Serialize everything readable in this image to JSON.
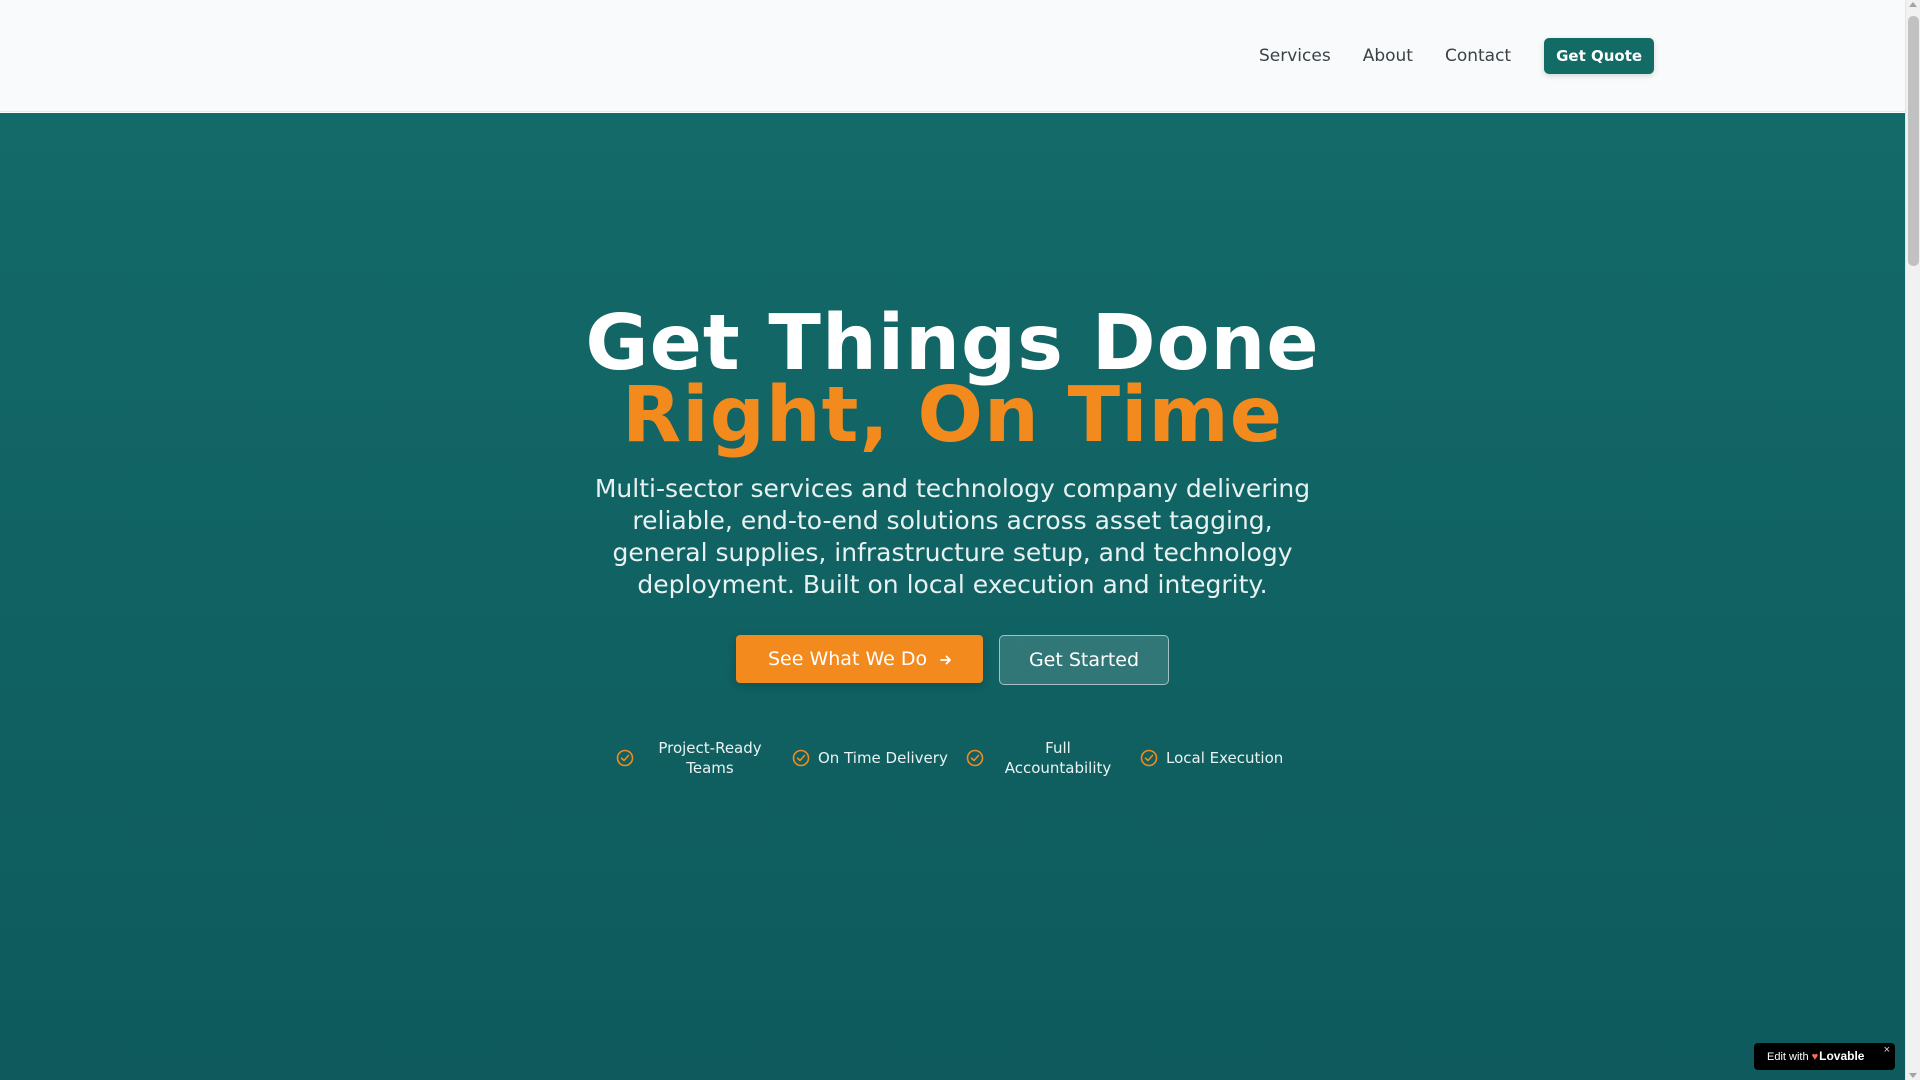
{
  "nav": {
    "links": [
      "Services",
      "About",
      "Contact"
    ],
    "cta": "Get Quote"
  },
  "hero": {
    "title_line1": "Get Things Done",
    "title_line2": "Right, On Time",
    "subtitle": "Multi-sector services and technology company delivering reliable, end-to-end solutions across asset tagging, general supplies, infrastructure setup, and technology deployment. Built on local execution and integrity.",
    "primary_button": "See What We Do",
    "primary_button_icon": "arrow-right-icon",
    "secondary_button": "Get Started",
    "features": [
      {
        "label": "Project-Ready Teams",
        "icon": "check-circle-icon"
      },
      {
        "label": "On Time Delivery",
        "icon": "check-circle-icon"
      },
      {
        "label": "Full Accountability",
        "icon": "check-circle-icon"
      },
      {
        "label": "Local Execution",
        "icon": "check-circle-icon"
      }
    ]
  },
  "badge": {
    "prefix": "Edit with",
    "brand": "Lovable",
    "close": "×"
  },
  "colors": {
    "teal": "#136b66",
    "orange": "#f28a1e",
    "hero_bg": "#116363"
  }
}
